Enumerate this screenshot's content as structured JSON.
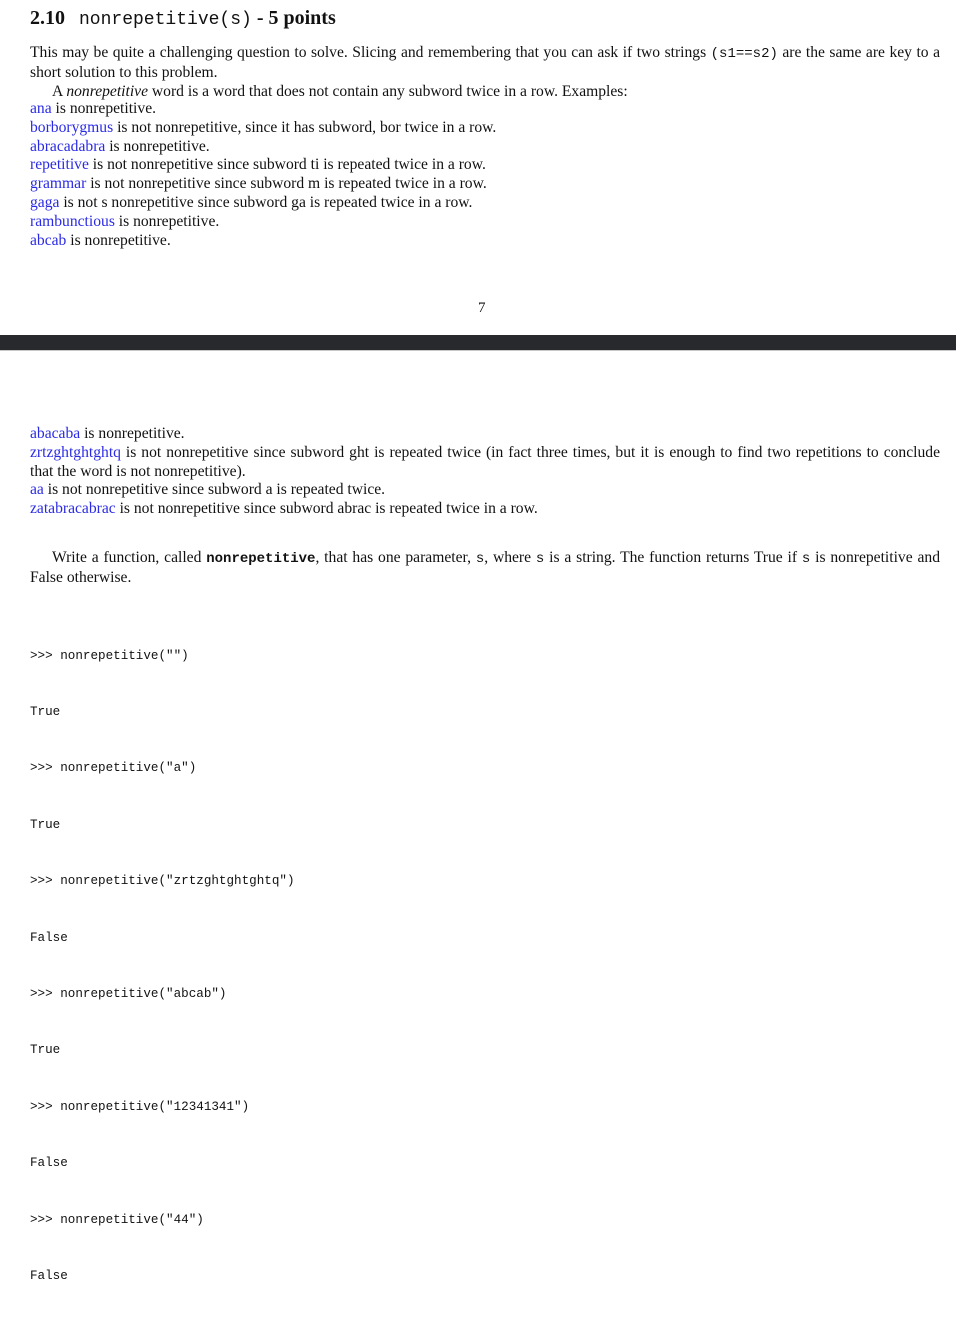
{
  "section": {
    "number": "2.10",
    "function_signature": "nonrepetitive(s)",
    "points_suffix": " - 5 points"
  },
  "intro": {
    "text_before_code": "This may be quite a challenging question to solve. Slicing and remembering that you can ask if two strings ",
    "code": "(s1==s2)",
    "text_after_code": " are the same are key to a short solution to this problem.",
    "definition_prefix": "A ",
    "definition_term": "nonrepetitive",
    "definition_suffix": " word is a word that does not contain any subword twice in a row. Examples:"
  },
  "examples_page1": [
    {
      "word": "ana",
      "text": " is nonrepetitive."
    },
    {
      "word": "borborygmus",
      "text": " is not nonrepetitive, since it has subword, bor twice in a row."
    },
    {
      "word": "abracadabra",
      "text": " is nonrepetitive."
    },
    {
      "word": "repetitive",
      "text": " is not nonrepetitive since subword ti is repeated twice in a row."
    },
    {
      "word": "grammar",
      "text": " is not nonrepetitive since subword m is repeated twice in a row."
    },
    {
      "word": "gaga",
      "text": " is not s nonrepetitive since subword ga is repeated twice in a row."
    },
    {
      "word": "rambunctious",
      "text": " is nonrepetitive."
    },
    {
      "word": "abcab",
      "text": " is nonrepetitive."
    }
  ],
  "page_number": "7",
  "examples_page2": [
    {
      "word": "abacaba",
      "text": " is nonrepetitive."
    },
    {
      "word": "zrtzghtghtghtq",
      "text": " is not nonrepetitive since subword ght is repeated twice (in fact three times, but it is enough to find two repetitions to conclude that the word is not nonrepetitive)."
    },
    {
      "word": "aa",
      "text": " is not nonrepetitive since subword a is repeated twice."
    },
    {
      "word": "zatabracabrac",
      "text": " is not nonrepetitive since subword abrac is repeated twice in a row."
    }
  ],
  "task": {
    "part1": "Write a function, called ",
    "fn_name": "nonrepetitive",
    "part2": ", that has one parameter, ",
    "param1": "s",
    "part3": ", where ",
    "param2": "s",
    "part4": " is a string. The function returns True if ",
    "param3": "s",
    "part5": " is nonrepetitive and False otherwise."
  },
  "doctest": [
    ">>> nonrepetitive(\"\")",
    "True",
    ">>> nonrepetitive(\"a\")",
    "True",
    ">>> nonrepetitive(\"zrtzghtghtghtq\")",
    "False",
    ">>> nonrepetitive(\"abcab\")",
    "True",
    ">>> nonrepetitive(\"12341341\")",
    "False",
    ">>> nonrepetitive(\"44\")",
    "False"
  ],
  "colors": {
    "link": "#2a2ae6",
    "text": "#111111",
    "page_gap": "#28292d",
    "background": "#ffffff"
  }
}
